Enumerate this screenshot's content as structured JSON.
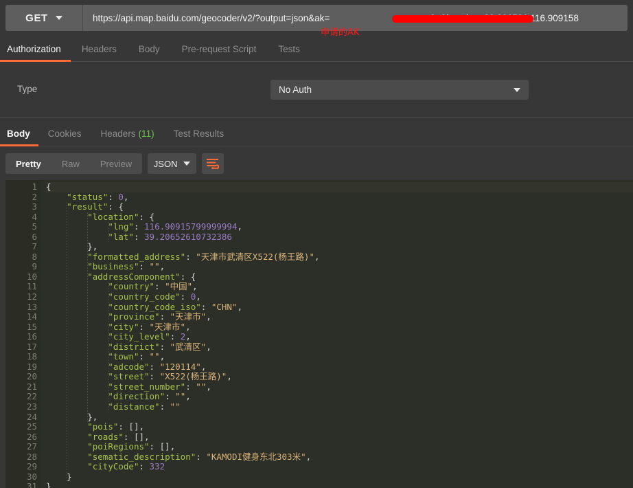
{
  "request": {
    "method": "GET",
    "method_caret_icon": "chevron-down-icon",
    "url": "https://api.map.baidu.com/geocoder/v2/?output=json&ak=",
    "url_suffix": "0e&location=39.206526,116.909158",
    "redaction_note": "申请的AK",
    "redaction_color": "#fe0000",
    "tabs": [
      {
        "label": "Authorization",
        "active": true
      },
      {
        "label": "Headers",
        "active": false
      },
      {
        "label": "Body",
        "active": false
      },
      {
        "label": "Pre-request Script",
        "active": false
      },
      {
        "label": "Tests",
        "active": false
      }
    ]
  },
  "auth": {
    "type_label": "Type",
    "type_value": "No Auth",
    "type_caret_icon": "chevron-down-icon"
  },
  "response": {
    "tabs": [
      {
        "label": "Body",
        "active": true
      },
      {
        "label": "Cookies",
        "active": false
      },
      {
        "label": "Headers",
        "count": "(11)",
        "active": false
      },
      {
        "label": "Test Results",
        "active": false
      }
    ],
    "formats": [
      {
        "label": "Pretty",
        "active": true
      },
      {
        "label": "Raw",
        "active": false
      },
      {
        "label": "Preview",
        "active": false
      }
    ],
    "language": "JSON",
    "language_caret_icon": "chevron-down-icon",
    "wrap_icon": "word-wrap-icon",
    "accent_color": "#ff6c37",
    "count_color": "#6cc24a"
  },
  "code": {
    "lines": [
      {
        "num": "1",
        "fold": true,
        "indent": 0,
        "tokens": [
          [
            "p",
            "{"
          ]
        ]
      },
      {
        "num": "2",
        "fold": false,
        "indent": 1,
        "tokens": [
          [
            "k",
            "\"status\""
          ],
          [
            "p",
            ": "
          ],
          [
            "n",
            "0"
          ],
          [
            "p",
            ","
          ]
        ]
      },
      {
        "num": "3",
        "fold": true,
        "indent": 1,
        "tokens": [
          [
            "k",
            "\"result\""
          ],
          [
            "p",
            ": {"
          ]
        ]
      },
      {
        "num": "4",
        "fold": true,
        "indent": 2,
        "tokens": [
          [
            "k",
            "\"location\""
          ],
          [
            "p",
            ": {"
          ]
        ]
      },
      {
        "num": "5",
        "fold": false,
        "indent": 3,
        "tokens": [
          [
            "k",
            "\"lng\""
          ],
          [
            "p",
            ": "
          ],
          [
            "n",
            "116.90915799999994"
          ],
          [
            "p",
            ","
          ]
        ]
      },
      {
        "num": "6",
        "fold": false,
        "indent": 3,
        "tokens": [
          [
            "k",
            "\"lat\""
          ],
          [
            "p",
            ": "
          ],
          [
            "n",
            "39.20652610732386"
          ]
        ]
      },
      {
        "num": "7",
        "fold": false,
        "indent": 2,
        "tokens": [
          [
            "p",
            "},"
          ]
        ]
      },
      {
        "num": "8",
        "fold": false,
        "indent": 2,
        "tokens": [
          [
            "k",
            "\"formatted_address\""
          ],
          [
            "p",
            ": "
          ],
          [
            "s",
            "\"天津市武清区X522(杨王路)\""
          ],
          [
            "p",
            ","
          ]
        ]
      },
      {
        "num": "9",
        "fold": false,
        "indent": 2,
        "tokens": [
          [
            "k",
            "\"business\""
          ],
          [
            "p",
            ": "
          ],
          [
            "s",
            "\"\""
          ],
          [
            "p",
            ","
          ]
        ]
      },
      {
        "num": "10",
        "fold": true,
        "indent": 2,
        "tokens": [
          [
            "k",
            "\"addressComponent\""
          ],
          [
            "p",
            ": {"
          ]
        ]
      },
      {
        "num": "11",
        "fold": false,
        "indent": 3,
        "tokens": [
          [
            "k",
            "\"country\""
          ],
          [
            "p",
            ": "
          ],
          [
            "s",
            "\"中国\""
          ],
          [
            "p",
            ","
          ]
        ]
      },
      {
        "num": "12",
        "fold": false,
        "indent": 3,
        "tokens": [
          [
            "k",
            "\"country_code\""
          ],
          [
            "p",
            ": "
          ],
          [
            "n",
            "0"
          ],
          [
            "p",
            ","
          ]
        ]
      },
      {
        "num": "13",
        "fold": false,
        "indent": 3,
        "tokens": [
          [
            "k",
            "\"country_code_iso\""
          ],
          [
            "p",
            ": "
          ],
          [
            "s",
            "\"CHN\""
          ],
          [
            "p",
            ","
          ]
        ]
      },
      {
        "num": "14",
        "fold": false,
        "indent": 3,
        "tokens": [
          [
            "k",
            "\"province\""
          ],
          [
            "p",
            ": "
          ],
          [
            "s",
            "\"天津市\""
          ],
          [
            "p",
            ","
          ]
        ]
      },
      {
        "num": "15",
        "fold": false,
        "indent": 3,
        "tokens": [
          [
            "k",
            "\"city\""
          ],
          [
            "p",
            ": "
          ],
          [
            "s",
            "\"天津市\""
          ],
          [
            "p",
            ","
          ]
        ]
      },
      {
        "num": "16",
        "fold": false,
        "indent": 3,
        "tokens": [
          [
            "k",
            "\"city_level\""
          ],
          [
            "p",
            ": "
          ],
          [
            "n",
            "2"
          ],
          [
            "p",
            ","
          ]
        ]
      },
      {
        "num": "17",
        "fold": false,
        "indent": 3,
        "tokens": [
          [
            "k",
            "\"district\""
          ],
          [
            "p",
            ": "
          ],
          [
            "s",
            "\"武清区\""
          ],
          [
            "p",
            ","
          ]
        ]
      },
      {
        "num": "18",
        "fold": false,
        "indent": 3,
        "tokens": [
          [
            "k",
            "\"town\""
          ],
          [
            "p",
            ": "
          ],
          [
            "s",
            "\"\""
          ],
          [
            "p",
            ","
          ]
        ]
      },
      {
        "num": "19",
        "fold": false,
        "indent": 3,
        "tokens": [
          [
            "k",
            "\"adcode\""
          ],
          [
            "p",
            ": "
          ],
          [
            "s",
            "\"120114\""
          ],
          [
            "p",
            ","
          ]
        ]
      },
      {
        "num": "20",
        "fold": false,
        "indent": 3,
        "tokens": [
          [
            "k",
            "\"street\""
          ],
          [
            "p",
            ": "
          ],
          [
            "s",
            "\"X522(杨王路)\""
          ],
          [
            "p",
            ","
          ]
        ]
      },
      {
        "num": "21",
        "fold": false,
        "indent": 3,
        "tokens": [
          [
            "k",
            "\"street_number\""
          ],
          [
            "p",
            ": "
          ],
          [
            "s",
            "\"\""
          ],
          [
            "p",
            ","
          ]
        ]
      },
      {
        "num": "22",
        "fold": false,
        "indent": 3,
        "tokens": [
          [
            "k",
            "\"direction\""
          ],
          [
            "p",
            ": "
          ],
          [
            "s",
            "\"\""
          ],
          [
            "p",
            ","
          ]
        ]
      },
      {
        "num": "23",
        "fold": false,
        "indent": 3,
        "tokens": [
          [
            "k",
            "\"distance\""
          ],
          [
            "p",
            ": "
          ],
          [
            "s",
            "\"\""
          ]
        ]
      },
      {
        "num": "24",
        "fold": false,
        "indent": 2,
        "tokens": [
          [
            "p",
            "},"
          ]
        ]
      },
      {
        "num": "25",
        "fold": false,
        "indent": 2,
        "tokens": [
          [
            "k",
            "\"pois\""
          ],
          [
            "p",
            ": [],"
          ]
        ]
      },
      {
        "num": "26",
        "fold": false,
        "indent": 2,
        "tokens": [
          [
            "k",
            "\"roads\""
          ],
          [
            "p",
            ": [],"
          ]
        ]
      },
      {
        "num": "27",
        "fold": false,
        "indent": 2,
        "tokens": [
          [
            "k",
            "\"poiRegions\""
          ],
          [
            "p",
            ": [],"
          ]
        ]
      },
      {
        "num": "28",
        "fold": false,
        "indent": 2,
        "tokens": [
          [
            "k",
            "\"sematic_description\""
          ],
          [
            "p",
            ": "
          ],
          [
            "s",
            "\"KAMODI健身东北303米\""
          ],
          [
            "p",
            ","
          ]
        ]
      },
      {
        "num": "29",
        "fold": false,
        "indent": 2,
        "tokens": [
          [
            "k",
            "\"cityCode\""
          ],
          [
            "p",
            ": "
          ],
          [
            "n",
            "332"
          ]
        ]
      },
      {
        "num": "30",
        "fold": false,
        "indent": 1,
        "tokens": [
          [
            "p",
            "}"
          ]
        ]
      },
      {
        "num": "31",
        "fold": false,
        "indent": 0,
        "tokens": [
          [
            "p",
            "}"
          ]
        ]
      }
    ]
  }
}
